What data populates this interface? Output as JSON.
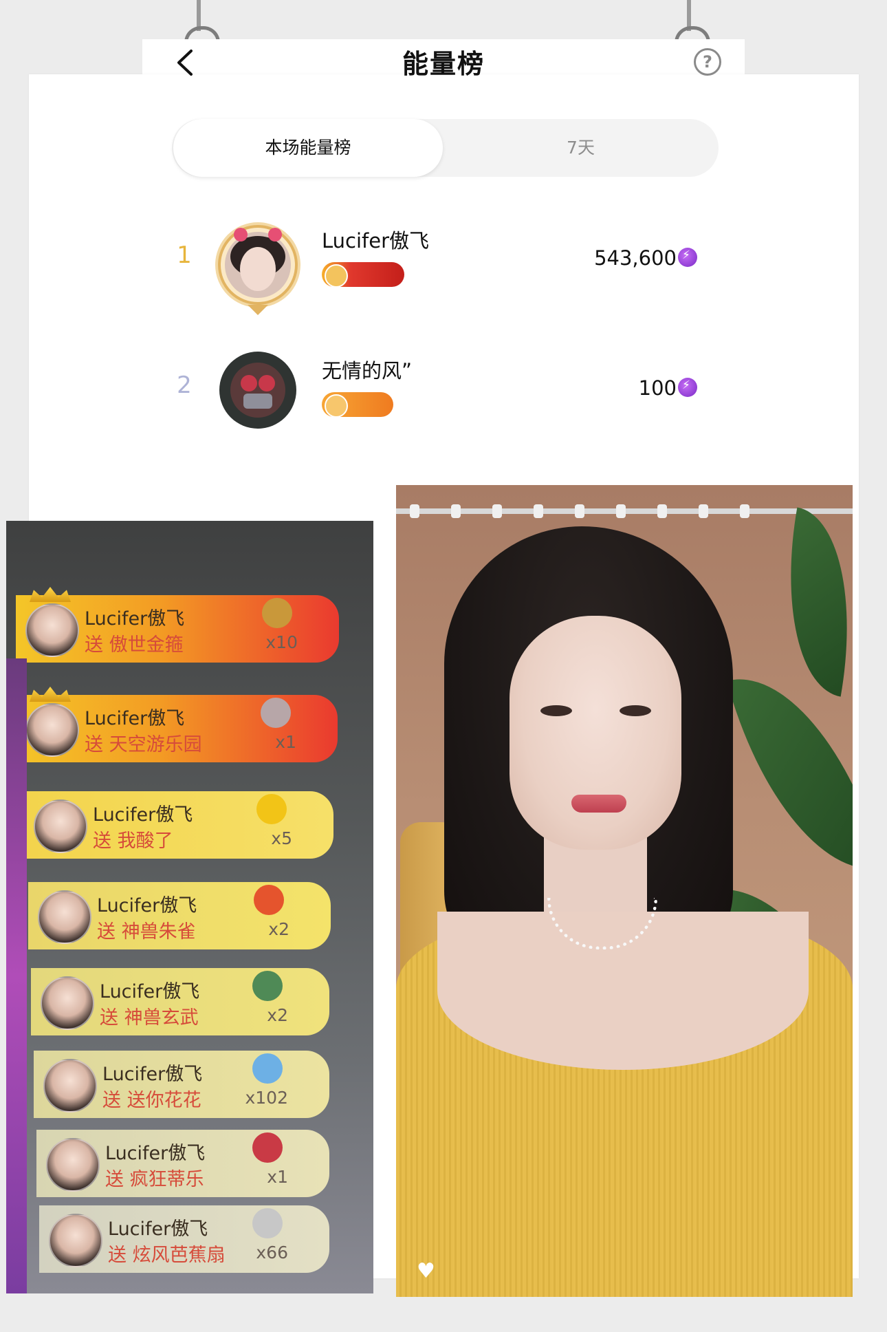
{
  "header": {
    "title": "能量榜",
    "back_icon": "chevron-left-icon",
    "help_icon": "question-circle-icon",
    "help_glyph": "?"
  },
  "tabs": [
    {
      "label": "本场能量榜",
      "active": true
    },
    {
      "label": "7天",
      "active": false
    }
  ],
  "ranking": [
    {
      "rank": "1",
      "name": "Lucifer傲飞",
      "score": "543,600",
      "badge_color": "#e0382d"
    },
    {
      "rank": "2",
      "name": "无情的风”",
      "score": "100",
      "badge_color": "#f08a2a"
    }
  ],
  "gift_messages": [
    {
      "name": "Lucifer傲飞",
      "text": "送 傲世金箍",
      "count": "x10"
    },
    {
      "name": "Lucifer傲飞",
      "text": "送 天空游乐园",
      "count": "x1"
    },
    {
      "name": "Lucifer傲飞",
      "text": "送 我酸了",
      "count": "x5"
    },
    {
      "name": "Lucifer傲飞",
      "text": "送 神兽朱雀",
      "count": "x2"
    },
    {
      "name": "Lucifer傲飞",
      "text": "送 神兽玄武",
      "count": "x2"
    },
    {
      "name": "Lucifer傲飞",
      "text": "送 送你花花",
      "count": "x102"
    },
    {
      "name": "Lucifer傲飞",
      "text": "送 疯狂蒂乐",
      "count": "x1"
    },
    {
      "name": "Lucifer傲飞",
      "text": "送 炫风芭蕉扇",
      "count": "x66"
    }
  ],
  "colors": {
    "rank_gold": "#e7b53c",
    "rank_silver": "#aeb3d6",
    "energy_purple": "#9a3de0"
  }
}
